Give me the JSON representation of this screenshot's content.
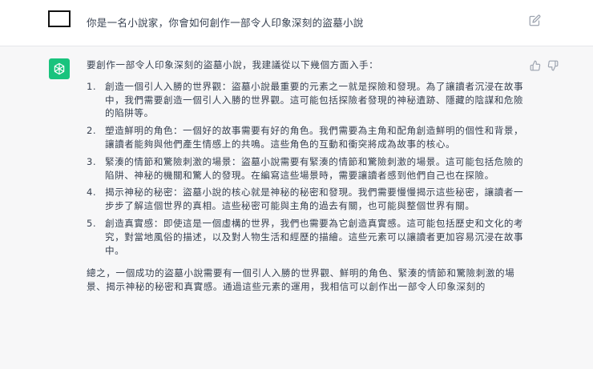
{
  "user_message": {
    "text": "你是一名小說家，你會如何創作一部令人印象深刻的盜墓小說"
  },
  "assistant_message": {
    "intro": "要創作一部令人印象深刻的盜墓小說，我建議從以下幾個方面入手：",
    "items": [
      {
        "num": "1.",
        "text": "創造一個引人入勝的世界觀：盜墓小說最重要的元素之一就是探險和發現。為了讓讀者沉浸在故事中，我們需要創造一個引人入勝的世界觀。這可能包括探險者發現的神秘遺跡、隱藏的陰謀和危險的陷阱等。"
      },
      {
        "num": "2.",
        "text": "塑造鮮明的角色：一個好的故事需要有好的角色。我們需要為主角和配角創造鮮明的個性和背景，讓讀者能夠與他們產生情感上的共鳴。這些角色的互動和衝突將成為故事的核心。"
      },
      {
        "num": "3.",
        "text": "緊湊的情節和驚險刺激的場景：盜墓小說需要有緊湊的情節和驚險刺激的場景。這可能包括危險的陷阱、神秘的機關和驚人的發現。在編寫這些場景時，需要讓讀者感到他們自己也在探險。"
      },
      {
        "num": "4.",
        "text": "揭示神秘的秘密：盜墓小說的核心就是神秘的秘密和發現。我們需要慢慢揭示這些秘密，讓讀者一步步了解這個世界的真相。這些秘密可能與主角的過去有關，也可能與整個世界有關。"
      },
      {
        "num": "5.",
        "text": "創造真實感：即使這是一個虛構的世界，我們也需要為它創造真實感。這可能包括歷史和文化的考究，對當地風俗的描述，以及對人物生活和經歷的描繪。這些元素可以讓讀者更加容易沉浸在故事中。"
      }
    ],
    "summary": "總之，一個成功的盜墓小說需要有一個引人入勝的世界觀、鮮明的角色、緊湊的情節和驚險刺激的場景、揭示神秘的秘密和真實感。通過這些元素的運用，我相信可以創作出一部令人印象深刻的"
  },
  "icons": {
    "edit": "edit-icon",
    "thumb_up": "thumbs-up-icon",
    "thumb_down": "thumbs-down-icon",
    "assistant_logo": "openai-logo-icon"
  },
  "colors": {
    "assistant_logo_bg": "#19c37d",
    "assistant_row_bg": "#f7f7f8"
  }
}
